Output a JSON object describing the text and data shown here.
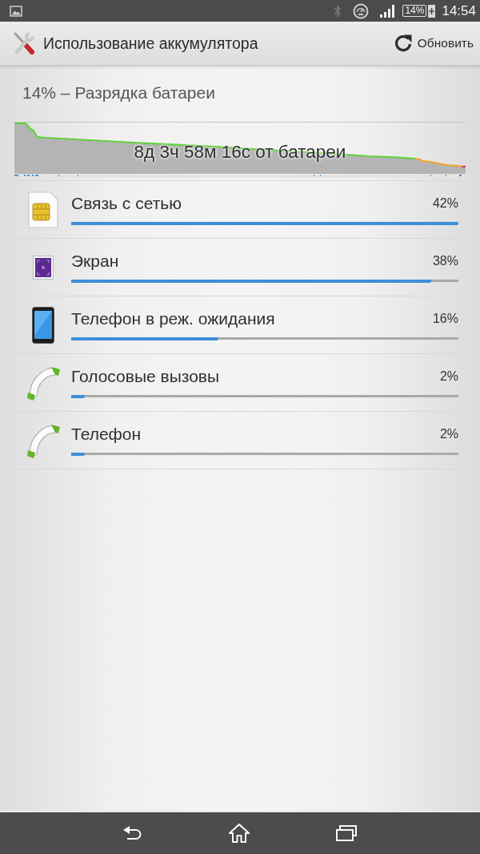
{
  "status_bar": {
    "battery_percent": "14%",
    "time": "14:54"
  },
  "action_bar": {
    "title": "Использование аккумулятора",
    "refresh_label": "Обновить"
  },
  "summary": "14% – Разрядка батареи",
  "history": {
    "caption": "8д 3ч 58м 16с от батареи"
  },
  "items": [
    {
      "kind": "sim",
      "name": "Связь с сетью",
      "percent": "42%",
      "level": 1
    },
    {
      "kind": "screen",
      "name": "Экран",
      "percent": "38%",
      "level": 0.93
    },
    {
      "kind": "standby",
      "name": "Телефон в реж. ожидания",
      "percent": "16%",
      "level": 0.38
    },
    {
      "kind": "call",
      "name": "Голосовые вызовы",
      "percent": "2%",
      "level": 0.035
    },
    {
      "kind": "call",
      "name": "Телефон",
      "percent": "2%",
      "level": 0.035
    }
  ]
}
